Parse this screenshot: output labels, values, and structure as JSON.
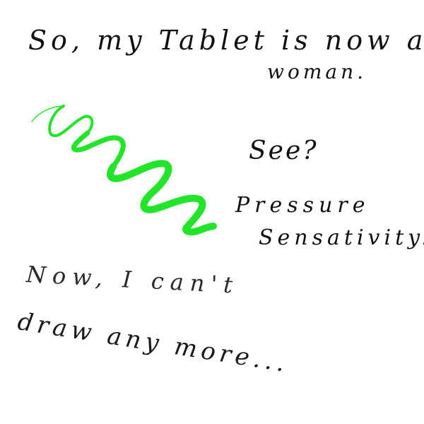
{
  "notes": {
    "line1": "So, my Tablet is now a",
    "line2": "woman.",
    "line3": "See?",
    "line4": "Pressure",
    "line5": "Sensativity.",
    "line6": "Now, I can't",
    "line7": "draw any more..."
  },
  "colors": {
    "ink": "#111111",
    "stroke": "#22e52a",
    "background": "#ffffff"
  },
  "drawing": {
    "icon": "green-squiggle-stroke"
  }
}
